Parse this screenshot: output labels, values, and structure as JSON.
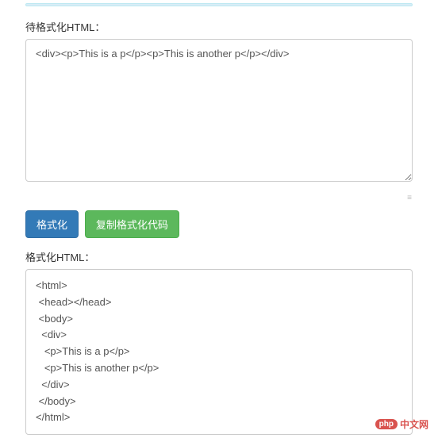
{
  "input_section": {
    "label": "待格式化HTML：",
    "value": "<div><p>This is a p</p><p>This is another p</p></div>"
  },
  "buttons": {
    "format": "格式化",
    "copy": "复制格式化代码"
  },
  "output_section": {
    "label": "格式化HTML：",
    "value": "<html>\n <head></head>\n <body>\n  <div>\n   <p>This is a p</p>\n   <p>This is another p</p>\n  </div>\n </body>\n</html>"
  },
  "watermark": {
    "badge": "php",
    "text": "中文网"
  }
}
